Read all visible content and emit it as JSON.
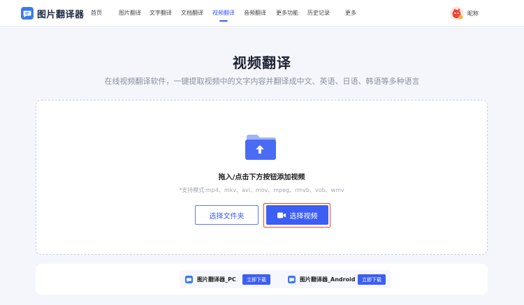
{
  "header": {
    "logo_text": "图片翻译器",
    "nav": [
      {
        "label": "首页",
        "active": false
      },
      {
        "label": "图片翻译",
        "active": false
      },
      {
        "label": "文字翻译",
        "active": false
      },
      {
        "label": "文档翻译",
        "active": false
      },
      {
        "label": "视频翻译",
        "active": true
      },
      {
        "label": "音频翻译",
        "active": false
      },
      {
        "label": "更多功能",
        "active": false
      },
      {
        "label": "历史记录",
        "active": false
      },
      {
        "label": "更多",
        "active": false
      }
    ],
    "username": "昵称"
  },
  "hero": {
    "title": "视频翻译",
    "subtitle": "在线视频翻译软件，一键提取视频中的文字内容并翻译成中文、英语、日语、韩语等多种语言"
  },
  "upload": {
    "hint": "拖入/点击下方按钮添加视频",
    "formats": "*支持模式:mp4、mkv、avi、mov、mpeg、rmvb、vob、wmv",
    "folder_button": "选择文件夹",
    "video_button": "选择视频"
  },
  "downloads": [
    {
      "name": "图片翻译器_PC",
      "button": "立即下载"
    },
    {
      "name": "图片翻译器_Android",
      "button": "立即下载"
    }
  ],
  "colors": {
    "accent": "#3c5ef2",
    "highlight_border": "#e8472f",
    "background": "#f4f6fb"
  },
  "icons": [
    "logo-icon",
    "avatar-icon",
    "folder-upload-icon",
    "video-camera-icon",
    "app-logo-icon"
  ]
}
